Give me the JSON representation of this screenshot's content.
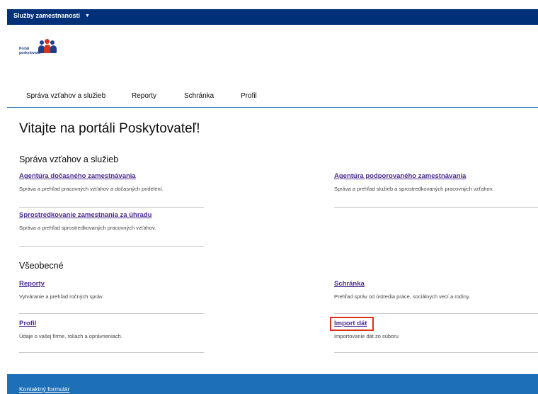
{
  "topbar": {
    "service_label": "Služby zamestnanosti"
  },
  "logo": {
    "line1": "Portál",
    "line2": "poskytovateľ"
  },
  "nav": [
    {
      "label": "Správa vzťahov a služieb"
    },
    {
      "label": "Reporty"
    },
    {
      "label": "Schránka"
    },
    {
      "label": "Profil"
    }
  ],
  "page": {
    "title": "Vitajte na portáli Poskytovateľ!"
  },
  "section1": {
    "heading": "Správa vzťahov a služieb",
    "cards": [
      {
        "link": "Agentúra dočasného zamestnávania",
        "desc": "Správa a prehľad pracovných vzťahov a dočasných pridelení."
      },
      {
        "link": "Agentúra podporovaného zamestnávania",
        "desc": "Správa a prehľad služieb a sprostredkovaných pracovných vzťahov."
      },
      {
        "link": "Sprostredkovanie zamestnania za úhradu",
        "desc": "Správa a prehľad sprostredkovaných pracovných vzťahov."
      }
    ]
  },
  "section2": {
    "heading": "Všeobecné",
    "cards": [
      {
        "link": "Reporty",
        "desc": "Vytváranie a prehľad ročných správ."
      },
      {
        "link": "Schránka",
        "desc": "Prehľad správ od ústredia práce, sociálnych vecí a rodiny."
      },
      {
        "link": "Profil",
        "desc": "Údaje o vašej firme, roliach a oprávneniach."
      },
      {
        "link": "Import dát",
        "desc": "Importovanie dát zo súboru"
      }
    ]
  },
  "footer": {
    "contact_link": "Kontaktný formulár"
  },
  "colors": {
    "topbar": "#003078",
    "footer": "#1d70b8",
    "link": "#4c2c92",
    "highlight": "#d4351c"
  },
  "icons": {
    "dropdown": "chevron-down-icon"
  }
}
